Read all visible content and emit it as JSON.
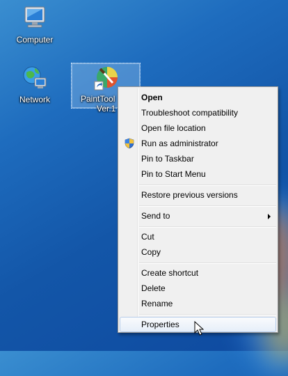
{
  "desktop": {
    "icons": [
      {
        "label": "Computer",
        "icon": "computer-icon"
      },
      {
        "label": "Network",
        "icon": "network-icon"
      },
      {
        "label": "PaintTool",
        "label2": "Ver.1",
        "icon": "painttool-shortcut-icon",
        "selected": true
      }
    ]
  },
  "context_menu": {
    "items": [
      {
        "label": "Open",
        "bold": true
      },
      {
        "label": "Troubleshoot compatibility"
      },
      {
        "label": "Open file location"
      },
      {
        "label": "Run as administrator",
        "icon": "uac-shield-icon"
      },
      {
        "label": "Pin to Taskbar"
      },
      {
        "label": "Pin to Start Menu"
      },
      {
        "label": "Restore previous versions"
      },
      {
        "label": "Send to",
        "submenu": true
      },
      {
        "label": "Cut"
      },
      {
        "label": "Copy"
      },
      {
        "label": "Create shortcut"
      },
      {
        "label": "Delete"
      },
      {
        "label": "Rename"
      },
      {
        "label": "Properties",
        "highlighted": true
      }
    ]
  },
  "colors": {
    "desktop_background": "#1e6cbe",
    "menu_background": "#f0f0f0",
    "menu_border": "#979797",
    "highlight_border": "#b7cdea"
  }
}
